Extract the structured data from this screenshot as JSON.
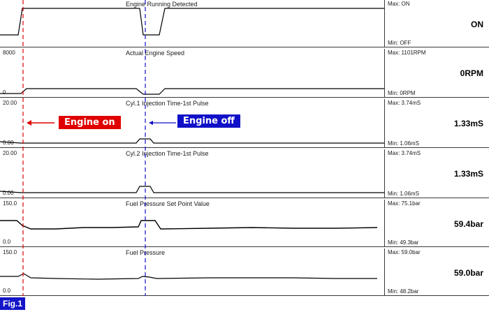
{
  "panels": [
    {
      "title": "Engine Running Detected",
      "ymax": "",
      "ymin": "",
      "max_label": "Max: ON",
      "min_label": "Min: OFF",
      "value": "ON"
    },
    {
      "title": "Actual Engine Speed",
      "ymax": "8000",
      "ymin": "0",
      "max_label": "Max:  1101RPM",
      "min_label": "Min:     0RPM",
      "value": "0RPM"
    },
    {
      "title": "Cyl.1 Injection Time-1st Pulse",
      "ymax": "20.00",
      "ymin": "0.00",
      "max_label": "Max:  3.74mS",
      "min_label": "Min:  1.06mS",
      "value": "1.33mS"
    },
    {
      "title": "Cyl.2 Injection Time-1st Pulse",
      "ymax": "20.00",
      "ymin": "0.00",
      "max_label": "Max:  3.74mS",
      "min_label": "Min:  1.06mS",
      "value": "1.33mS"
    },
    {
      "title": "Fuel Pressure Set Point Value",
      "ymax": "150.0",
      "ymin": "0.0",
      "max_label": "Max:  75.1bar",
      "min_label": "Min:  49.3bar",
      "value": "59.4bar"
    },
    {
      "title": "Fuel Pressure",
      "ymax": "150.0",
      "ymin": "0.0",
      "max_label": "Max:  59.0bar",
      "min_label": "Min:  48.2bar",
      "value": "59.0bar"
    }
  ],
  "annotations": {
    "engine_on": "Engine on",
    "engine_off": "Engine off",
    "engine_on_color": "#e00000",
    "engine_off_color": "#1010c8"
  },
  "figure_label": "Fig.1"
}
